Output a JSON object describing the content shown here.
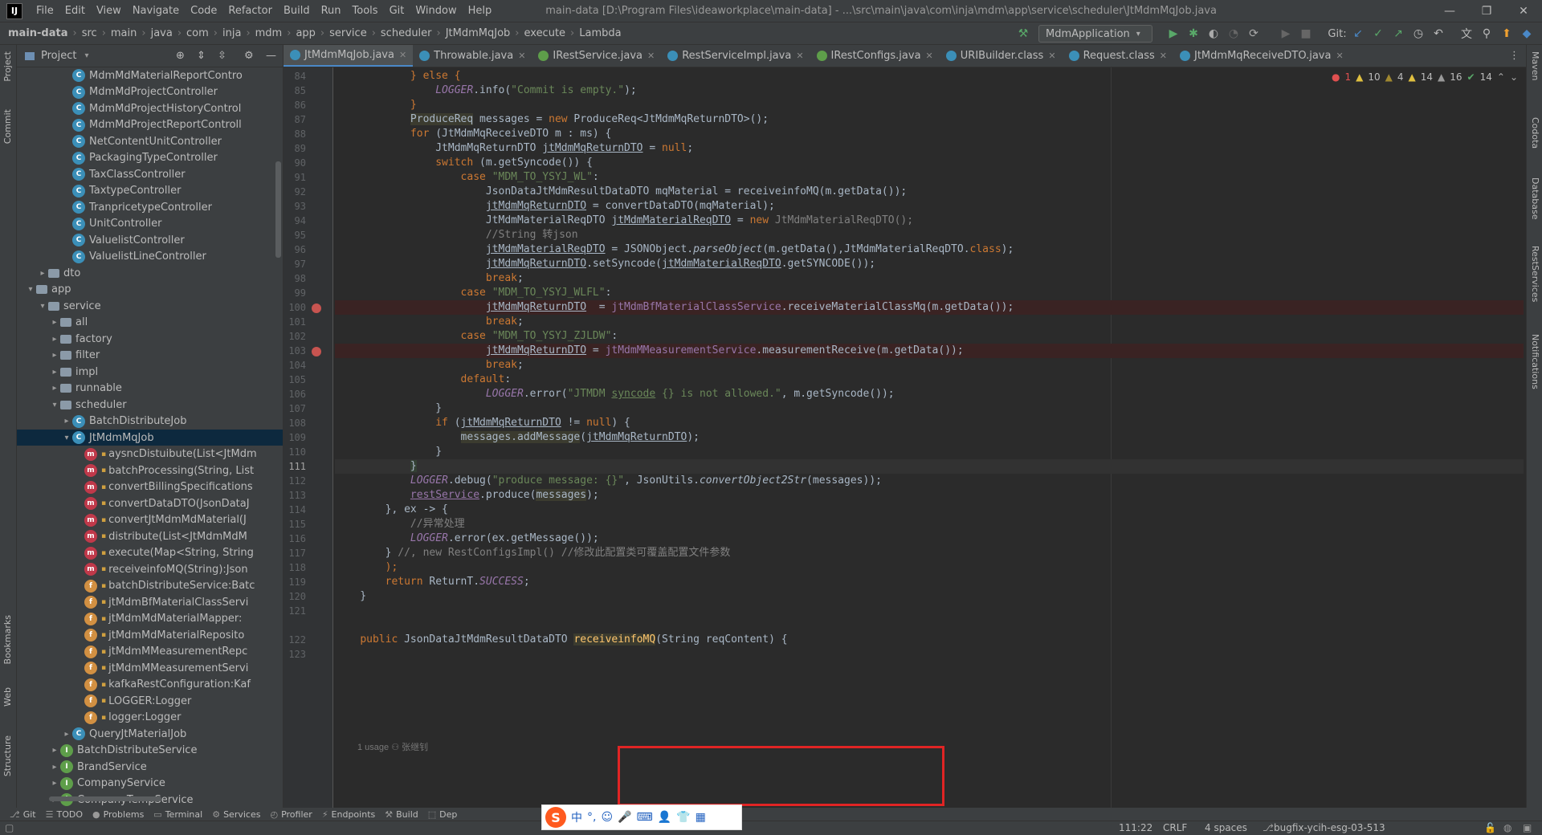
{
  "titlebar": {
    "menu": [
      "File",
      "Edit",
      "View",
      "Navigate",
      "Code",
      "Refactor",
      "Build",
      "Run",
      "Tools",
      "Git",
      "Window",
      "Help"
    ],
    "title": "main-data [D:\\Program Files\\ideaworkplace\\main-data] - ...\\src\\main\\java\\com\\inja\\mdm\\app\\service\\scheduler\\JtMdmMqJob.java"
  },
  "navbar": {
    "breadcrumbs": [
      "main-data",
      "src",
      "main",
      "java",
      "com",
      "inja",
      "mdm",
      "app",
      "service",
      "scheduler",
      "JtMdmMqJob",
      "execute",
      "Lambda"
    ],
    "run_config": "MdmApplication",
    "git_label": "Git:"
  },
  "project": {
    "header": "Project",
    "rows": [
      {
        "indent": 5,
        "icon": "class",
        "name": "MdmMdMaterialReportContro"
      },
      {
        "indent": 5,
        "icon": "class",
        "name": "MdmMdProjectController"
      },
      {
        "indent": 5,
        "icon": "class",
        "name": "MdmMdProjectHistoryControl"
      },
      {
        "indent": 5,
        "icon": "class",
        "name": "MdmMdProjectReportControll"
      },
      {
        "indent": 5,
        "icon": "class",
        "name": "NetContentUnitController"
      },
      {
        "indent": 5,
        "icon": "class",
        "name": "PackagingTypeController"
      },
      {
        "indent": 5,
        "icon": "class",
        "name": "TaxClassController"
      },
      {
        "indent": 5,
        "icon": "class",
        "name": "TaxtypeController"
      },
      {
        "indent": 5,
        "icon": "class",
        "name": "TranpricetypeController"
      },
      {
        "indent": 5,
        "icon": "class",
        "name": "UnitController"
      },
      {
        "indent": 5,
        "icon": "class",
        "name": "ValuelistController"
      },
      {
        "indent": 5,
        "icon": "class",
        "name": "ValuelistLineController"
      },
      {
        "indent": 3,
        "icon": "folder",
        "name": "dto",
        "arrow": ">"
      },
      {
        "indent": 2,
        "icon": "folder",
        "name": "app",
        "arrow": "v"
      },
      {
        "indent": 3,
        "icon": "folder",
        "name": "service",
        "arrow": "v"
      },
      {
        "indent": 4,
        "icon": "folder",
        "name": "all",
        "arrow": ">"
      },
      {
        "indent": 4,
        "icon": "folder",
        "name": "factory",
        "arrow": ">"
      },
      {
        "indent": 4,
        "icon": "folder",
        "name": "filter",
        "arrow": ">"
      },
      {
        "indent": 4,
        "icon": "folder",
        "name": "impl",
        "arrow": ">"
      },
      {
        "indent": 4,
        "icon": "folder",
        "name": "runnable",
        "arrow": ">"
      },
      {
        "indent": 4,
        "icon": "folder",
        "name": "scheduler",
        "arrow": "v"
      },
      {
        "indent": 5,
        "icon": "class",
        "name": "BatchDistributeJob",
        "arrow": ">"
      },
      {
        "indent": 5,
        "icon": "class",
        "name": "JtMdmMqJob",
        "arrow": "v",
        "selected": true
      },
      {
        "indent": 6,
        "icon": "method",
        "name": "aysncDistuibute(List<JtMdm"
      },
      {
        "indent": 6,
        "icon": "method",
        "name": "batchProcessing(String, List"
      },
      {
        "indent": 6,
        "icon": "method",
        "name": "convertBillingSpecifications"
      },
      {
        "indent": 6,
        "icon": "method",
        "name": "convertDataDTO(JsonDataJ"
      },
      {
        "indent": 6,
        "icon": "method",
        "name": "convertJtMdmMdMaterial(J"
      },
      {
        "indent": 6,
        "icon": "method",
        "name": "distribute(List<JtMdmMdM"
      },
      {
        "indent": 6,
        "icon": "method",
        "name": "execute(Map<String, String"
      },
      {
        "indent": 6,
        "icon": "method",
        "name": "receiveinfoMQ(String):Json"
      },
      {
        "indent": 6,
        "icon": "field",
        "name": "batchDistributeService:Batc"
      },
      {
        "indent": 6,
        "icon": "field",
        "name": "jtMdmBfMaterialClassServi"
      },
      {
        "indent": 6,
        "icon": "field",
        "name": "jtMdmMdMaterialMapper:"
      },
      {
        "indent": 6,
        "icon": "field",
        "name": "jtMdmMdMaterialReposito"
      },
      {
        "indent": 6,
        "icon": "field",
        "name": "jtMdmMMeasurementRepc"
      },
      {
        "indent": 6,
        "icon": "field",
        "name": "jtMdmMMeasurementServi"
      },
      {
        "indent": 6,
        "icon": "field",
        "name": "kafkaRestConfiguration:Kaf"
      },
      {
        "indent": 6,
        "icon": "field",
        "name": "LOGGER:Logger"
      },
      {
        "indent": 6,
        "icon": "field",
        "name": "logger:Logger"
      },
      {
        "indent": 5,
        "icon": "class",
        "name": "QueryJtMaterialJob",
        "arrow": ">"
      },
      {
        "indent": 4,
        "icon": "iface",
        "name": "BatchDistributeService",
        "arrow": ">"
      },
      {
        "indent": 4,
        "icon": "iface",
        "name": "BrandService",
        "arrow": ">"
      },
      {
        "indent": 4,
        "icon": "iface",
        "name": "CompanyService",
        "arrow": ">"
      },
      {
        "indent": 4,
        "icon": "iface",
        "name": "CompanyTempService",
        "arrow": ">"
      }
    ]
  },
  "tabs": [
    {
      "label": "JtMdmMqJob.java",
      "icon": "class",
      "active": true
    },
    {
      "label": "Throwable.java",
      "icon": "class"
    },
    {
      "label": "IRestService.java",
      "icon": "iface"
    },
    {
      "label": "RestServiceImpl.java",
      "icon": "class"
    },
    {
      "label": "IRestConfigs.java",
      "icon": "iface"
    },
    {
      "label": "URIBuilder.class",
      "icon": "class"
    },
    {
      "label": "Request.class",
      "icon": "class"
    },
    {
      "label": "JtMdmMqReceiveDTO.java",
      "icon": "class"
    }
  ],
  "inspections": {
    "errors": "1",
    "warn1": "10",
    "warn2": "4",
    "warn3": "14",
    "warn4": "16",
    "ok": "14"
  },
  "code_lines": [
    {
      "n": "84",
      "html": "            <span class=\"kw\">} else {</span>"
    },
    {
      "n": "85",
      "html": "                <span class=\"fld itl\">LOGGER</span>.info(<span class=\"str\">\"Commit is empty.\"</span>);"
    },
    {
      "n": "86",
      "html": "            <span class=\"kw\">}</span>"
    },
    {
      "n": "87",
      "html": "            <span class=\"hlbox\">ProduceReq</span> messages = <span class=\"kw\">new</span> ProduceReq&lt;JtMdmMqReturnDTO&gt;();"
    },
    {
      "n": "88",
      "html": "            <span class=\"kw\">for</span> (JtMdmMqReceiveDTO m : ms) {"
    },
    {
      "n": "89",
      "html": "                JtMdmMqReturnDTO <span class=\"ul\">jtMdmMqReturnDTO</span> = <span class=\"kw\">null</span>;"
    },
    {
      "n": "90",
      "html": "                <span class=\"kw\">switch</span> (m.getSyncode()) {"
    },
    {
      "n": "91",
      "html": "                    <span class=\"kw\">case</span> <span class=\"str\">\"MDM_TO_YSYJ_WL\"</span>:"
    },
    {
      "n": "92",
      "html": "                        JsonDataJtMdmResultDataDTO mqMaterial = receiveinfoMQ(m.getData());"
    },
    {
      "n": "93",
      "html": "                        <span class=\"ul\">jtMdmMqReturnDTO</span> = convertDataDTO(mqMaterial);"
    },
    {
      "n": "94",
      "html": "                        JtMdmMaterialReqDTO <span class=\"ul\">jtMdmMaterialReqDTO</span> = <span class=\"kw\">new</span> <span class=\"cmt\">JtMdmMaterialReqDTO();</span>"
    },
    {
      "n": "95",
      "html": "                        <span class=\"cmt\">//String 转json</span>"
    },
    {
      "n": "96",
      "html": "                        <span class=\"ul\">jtMdmMaterialReqDTO</span> = JSONObject.<span class=\"itl\">parseObject</span>(m.getData(),JtMdmMaterialReqDTO.<span class=\"kw\">class</span>);"
    },
    {
      "n": "97",
      "html": "                        <span class=\"ul\">jtMdmMqReturnDTO</span>.setSyncode(<span class=\"ul\">jtMdmMaterialReqDTO</span>.getSYNCODE());"
    },
    {
      "n": "98",
      "html": "                        <span class=\"kw\">break</span>;"
    },
    {
      "n": "99",
      "html": "                    <span class=\"kw\">case</span> <span class=\"str\">\"MDM_TO_YSYJ_WLFL\"</span>:"
    },
    {
      "n": "100",
      "bp": true,
      "html": "                        <span class=\"ul\">jtMdmMqReturnDTO</span>  = <span class=\"fld\">jtMdmBfMaterialClassService</span>.receiveMaterialClassMq(m.getData());"
    },
    {
      "n": "101",
      "html": "                        <span class=\"kw\">break</span>;"
    },
    {
      "n": "102",
      "html": "                    <span class=\"kw\">case</span> <span class=\"str\">\"MDM_TO_YSYJ_ZJLDW\"</span>:"
    },
    {
      "n": "103",
      "bp": true,
      "html": "                        <span class=\"ul\">jtMdmMqReturnDTO</span> = <span class=\"fld\">jtMdmMMeasurementService</span>.measurementReceive(m.getData());"
    },
    {
      "n": "104",
      "html": "                        <span class=\"kw\">break</span>;"
    },
    {
      "n": "105",
      "html": "                    <span class=\"kw\">default</span>:"
    },
    {
      "n": "106",
      "html": "                        <span class=\"fld itl\">LOGGER</span>.error(<span class=\"str\">\"JTMDM <span class=\"ul\">syncode</span> {} is not allowed.\"</span>, m.getSyncode());"
    },
    {
      "n": "107",
      "html": "                }"
    },
    {
      "n": "108",
      "html": "                <span class=\"kw\">if</span> (<span class=\"ul\">jtMdmMqReturnDTO</span> != <span class=\"kw\">null</span>) {"
    },
    {
      "n": "109",
      "html": "                    <span class=\"hlbox\">messages.addMessage</span>(<span class=\"ul\">jtMdmMqReturnDTO</span>);"
    },
    {
      "n": "110",
      "html": "                }"
    },
    {
      "n": "111",
      "cur": true,
      "html": "            <span class=\"hlvar\">}</span>"
    },
    {
      "n": "112",
      "html": "            <span class=\"fld itl\">LOGGER</span>.debug(<span class=\"str\">\"produce message: {}\"</span>, JsonUtils.<span class=\"itl\">convertObject2Str</span>(messages));"
    },
    {
      "n": "113",
      "html": "            <span class=\"fld ul\">restService</span>.produce(<span class=\"hlbox\">messages</span>);"
    },
    {
      "n": "114",
      "html": "        }, ex -&gt; {"
    },
    {
      "n": "115",
      "html": "            <span class=\"cmt\">//异常处理</span>"
    },
    {
      "n": "116",
      "html": "            <span class=\"fld itl\">LOGGER</span>.error(ex.getMessage());"
    },
    {
      "n": "117",
      "html": "        } <span class=\"cmt\">//, new RestConfigsImpl() //修改此配置类可覆盖配置文件参数</span>"
    },
    {
      "n": "118",
      "html": "        <span class=\"kw\">);</span>"
    },
    {
      "n": "119",
      "html": "        <span class=\"kw\">return</span> ReturnT.<span class=\"fld itl\">SUCCESS</span>;"
    },
    {
      "n": "120",
      "html": "    }"
    },
    {
      "n": "121",
      "html": ""
    },
    {
      "n": "122",
      "html": "    <span class=\"kw\">public</span> JsonDataJtMdmResultDataDTO <span class=\"meth hlbox\">receiveinfoMQ</span>(String reqContent) {"
    },
    {
      "n": "123",
      "html": ""
    }
  ],
  "usage_hint": "1 usage  ⚇ 张继钊",
  "bottom_tools": [
    "Git",
    "TODO",
    "Problems",
    "Terminal",
    "Services",
    "Profiler",
    "Endpoints",
    "Build",
    "Dep"
  ],
  "status": {
    "position": "111:22",
    "line_sep": "CRLF",
    "indent": "4 spaces",
    "branch": "bugfix-ycih-esg-03-513"
  },
  "ime": {
    "logo": "S",
    "mode": "中",
    "punct": "°,"
  },
  "left_stripe": [
    "Project",
    "Commit",
    "Bookmarks",
    "Web",
    "Structure"
  ],
  "right_stripe": [
    "Maven",
    "Codota",
    "Database",
    "RestServices",
    "Notifications"
  ]
}
